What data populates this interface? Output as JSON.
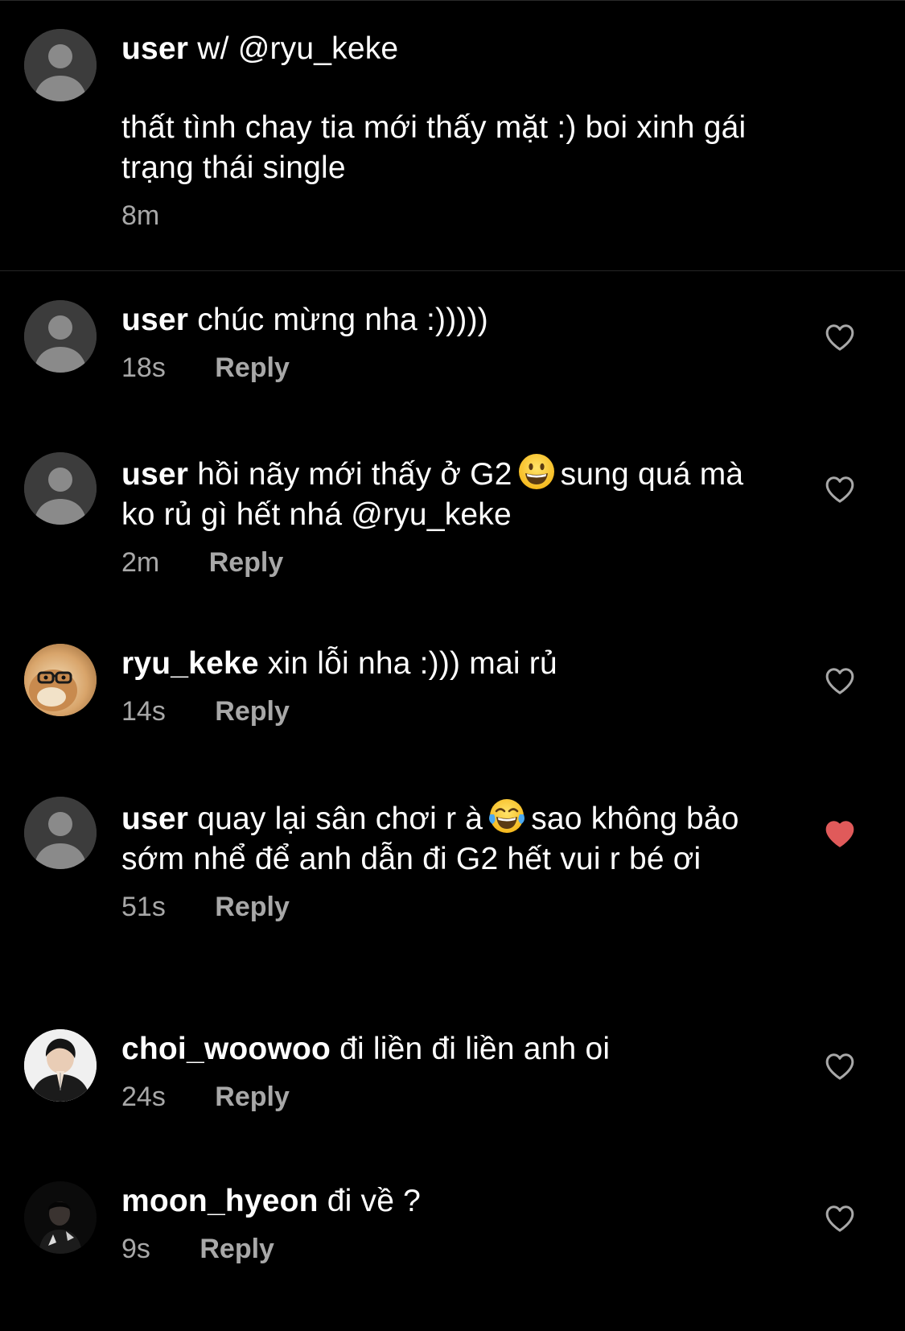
{
  "caption": {
    "username": "user",
    "tag_prefix": "w/",
    "tag_handle": "@ryu_keke",
    "text": "thất tình chay tia mới thấy mặt :) boi xinh gái trạng thái single",
    "time": "8m"
  },
  "comments": [
    {
      "username": "user",
      "text_before": "chúc mừng nha :)))))",
      "emoji": "",
      "text_after": "",
      "time": "18s",
      "reply_label": "Reply",
      "liked": false,
      "avatar": "default-avatar-icon"
    },
    {
      "username": "user",
      "text_before": "hồi nãy mới thấy ở G2",
      "emoji": "grinning-face-icon",
      "text_after": "sung quá mà ko rủ gì hết nhá @ryu_keke",
      "time": "2m",
      "reply_label": "Reply",
      "liked": false,
      "avatar": "default-avatar-icon"
    },
    {
      "username": "ryu_keke",
      "text_before": "xin lỗi nha :))) mai rủ",
      "emoji": "",
      "text_after": "",
      "time": "14s",
      "reply_label": "Reply",
      "liked": false,
      "avatar": "hamster-with-glasses-photo"
    },
    {
      "username": "user",
      "text_before": "quay lại sân chơi r à",
      "emoji": "tears-of-joy-icon",
      "text_after": "sao không bảo sớm nhể để anh dẫn đi G2 hết vui r bé ơi",
      "time": "51s",
      "reply_label": "Reply",
      "liked": true,
      "avatar": "default-avatar-icon"
    },
    {
      "username": "choi_woowoo",
      "text_before": "đi liền đi liền anh oi",
      "emoji": "",
      "text_after": "",
      "time": "24s",
      "reply_label": "Reply",
      "liked": false,
      "avatar": "person-praying-photo"
    },
    {
      "username": "moon_hyeon",
      "text_before": "đi về ?",
      "emoji": "",
      "text_after": "",
      "time": "9s",
      "reply_label": "Reply",
      "liked": false,
      "avatar": "dark-portrait-photo"
    }
  ],
  "colors": {
    "background": "#000000",
    "text": "#ffffff",
    "secondary_text": "#a8a8a8",
    "liked_heart": "#e05a5a",
    "default_avatar_bg": "#3c3c3c",
    "default_avatar_fg": "#8a8a8a"
  }
}
